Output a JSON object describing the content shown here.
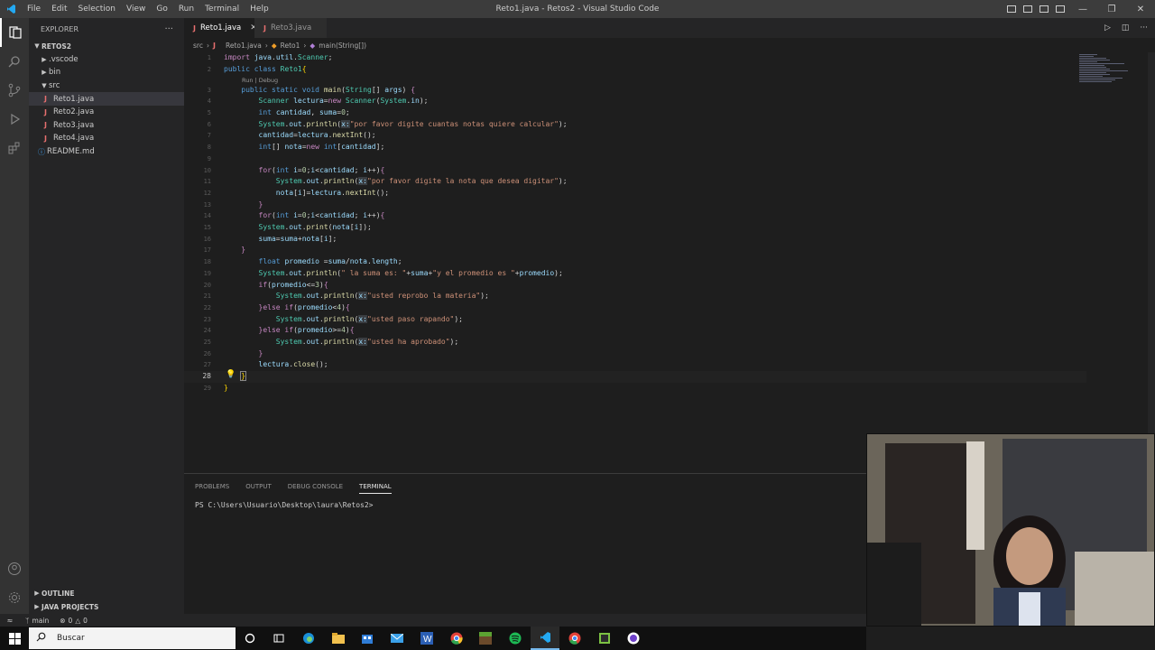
{
  "app": {
    "title": "Reto1.java - Retos2 - Visual Studio Code",
    "menu": [
      "File",
      "Edit",
      "Selection",
      "View",
      "Go",
      "Run",
      "Terminal",
      "Help"
    ]
  },
  "sidebar": {
    "header": "EXPLORER",
    "more_label": "···",
    "root": "RETOS2",
    "items": [
      {
        "label": ".vscode",
        "kind": "folder",
        "expanded": false
      },
      {
        "label": "bin",
        "kind": "folder",
        "expanded": false
      },
      {
        "label": "src",
        "kind": "folder",
        "expanded": true
      },
      {
        "label": "Reto1.java",
        "kind": "java",
        "selected": true
      },
      {
        "label": "Reto2.java",
        "kind": "java"
      },
      {
        "label": "Reto3.java",
        "kind": "java"
      },
      {
        "label": "Reto4.java",
        "kind": "java"
      },
      {
        "label": "README.md",
        "kind": "info"
      }
    ],
    "outline": "OUTLINE",
    "java_projects": "JAVA PROJECTS"
  },
  "tabs": [
    {
      "label": "Reto1.java",
      "active": true
    },
    {
      "label": "Reto3.java",
      "active": false
    }
  ],
  "breadcrumb": [
    "src",
    "Reto1.java",
    "Reto1",
    "main(String[])"
  ],
  "editor": {
    "codelens": "Run | Debug",
    "current_line": "28"
  },
  "panel": {
    "tabs": [
      "PROBLEMS",
      "OUTPUT",
      "DEBUG CONSOLE",
      "TERMINAL"
    ],
    "active_tab": "TERMINAL",
    "terminal_prompt": "PS C:\\Users\\Usuario\\Desktop\\laura\\Retos2>"
  },
  "statusbar": {
    "branch": "main",
    "problems": "0",
    "warnings": "0"
  },
  "taskbar": {
    "search_placeholder": "Buscar"
  },
  "colors": {
    "accent": "#007acc",
    "java_icon": "#e76f6f",
    "keyword": "#569cd6",
    "string": "#ce9178"
  }
}
